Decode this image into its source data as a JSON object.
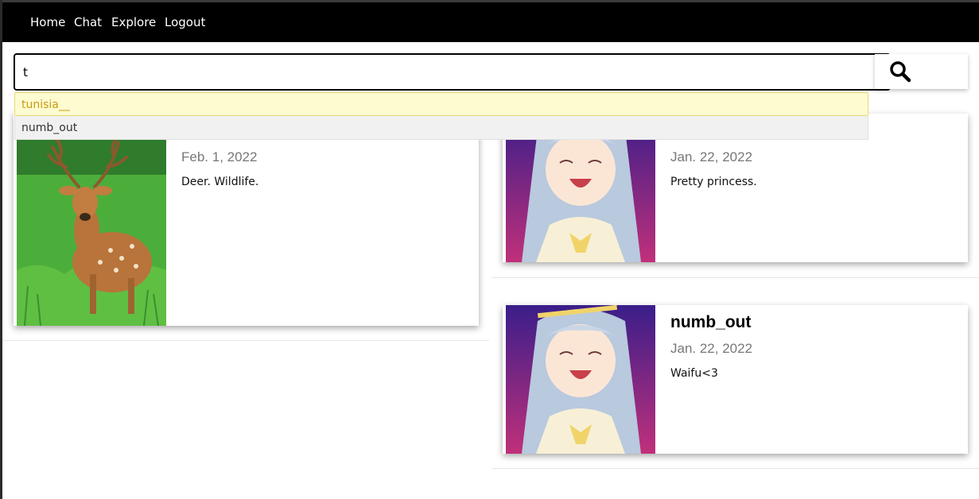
{
  "nav": {
    "links": [
      "Home",
      "Chat",
      "Explore",
      "Logout"
    ]
  },
  "search": {
    "value": "t",
    "button_icon": "search-icon",
    "suggestions": [
      "tunisia__",
      "numb_out"
    ]
  },
  "posts": [
    {
      "author": "",
      "date": "Feb. 1, 2022",
      "text": "Deer. Wildlife.",
      "image": "deer-photo"
    },
    {
      "author": "",
      "date": "Jan. 22, 2022",
      "text": "Pretty princess.",
      "image": "anime-girl-art"
    },
    {
      "author": "numb_out",
      "date": "Jan. 22, 2022",
      "text": "Waifu<3",
      "image": "anime-girl-art"
    }
  ],
  "colors": {
    "navbar_bg": "#000000",
    "suggestion_highlight_bg": "#fdfbd0",
    "suggestion_highlight_text": "#c89b10"
  }
}
